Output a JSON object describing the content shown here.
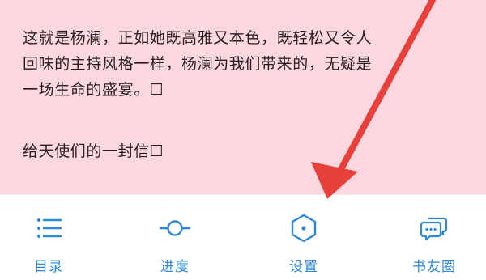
{
  "reader": {
    "paragraphs": [
      "这就是杨澜，正如她既高雅又本色，既轻松又令人",
      "回味的主持风格一样，杨澜为我们带来的，无疑是",
      "一场生命的盛宴。☐",
      "给天使们的一封信☐"
    ]
  },
  "toolbar": {
    "accent_color": "#2f88d8",
    "items": [
      {
        "label": "目录",
        "icon": "list-icon"
      },
      {
        "label": "进度",
        "icon": "progress-slider-icon"
      },
      {
        "label": "设置",
        "icon": "hexagon-settings-icon"
      },
      {
        "label": "书友圈",
        "icon": "chat-bubbles-icon"
      }
    ]
  },
  "annotation": {
    "arrow_color": "#e8403a",
    "points_to": "设置"
  }
}
